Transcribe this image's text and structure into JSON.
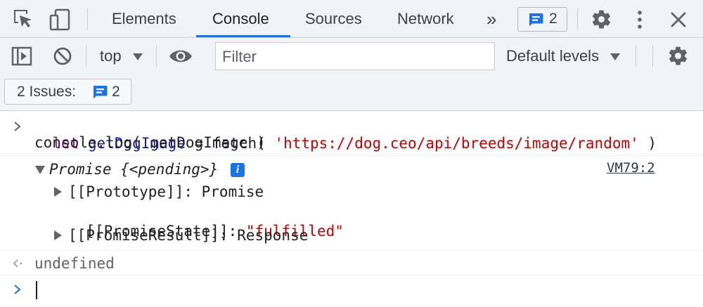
{
  "tabbar": {
    "tabs": [
      {
        "label": "Elements",
        "active": false
      },
      {
        "label": "Console",
        "active": true
      },
      {
        "label": "Sources",
        "active": false
      },
      {
        "label": "Network",
        "active": false
      }
    ],
    "overflow_label": "»",
    "issues_count": "2",
    "icons": [
      "inspect-element-icon",
      "device-toolbar-icon",
      "message-icon",
      "gear-icon",
      "kebab-menu-icon",
      "close-icon"
    ]
  },
  "toolbar": {
    "context": "top",
    "filter_placeholder": "Filter",
    "levels": "Default levels",
    "icons": [
      "sidebar-toggle-icon",
      "clear-console-icon",
      "live-expression-eye-icon",
      "console-settings-gear-icon"
    ]
  },
  "issues_bar": {
    "label": "2 Issues:",
    "count": "2"
  },
  "console": {
    "input": {
      "line1": {
        "kw": "let",
        "ident": "getDogImage",
        "op": " = fetch( ",
        "url": "'https://dog.ceo/api/breeds/image/random'",
        "close": " )"
      },
      "line2": "console.log( getDogImage )"
    },
    "output": {
      "promise_label": "Promise {<pending>}",
      "source": "VM79:2",
      "info_icon": "i",
      "props": {
        "prototype": "[[Prototype]]: Promise",
        "state_key": "[[PromiseState]]: ",
        "state_value": "\"fulfilled\"",
        "result": "[[PromiseResult]]: Response"
      }
    },
    "return_value": "undefined"
  },
  "colors": {
    "accent": "#1a73e8",
    "keyword": "#881280",
    "identifier": "#1a1aa6",
    "string": "#c80000",
    "toolbar_bg": "#f1f3f4"
  }
}
